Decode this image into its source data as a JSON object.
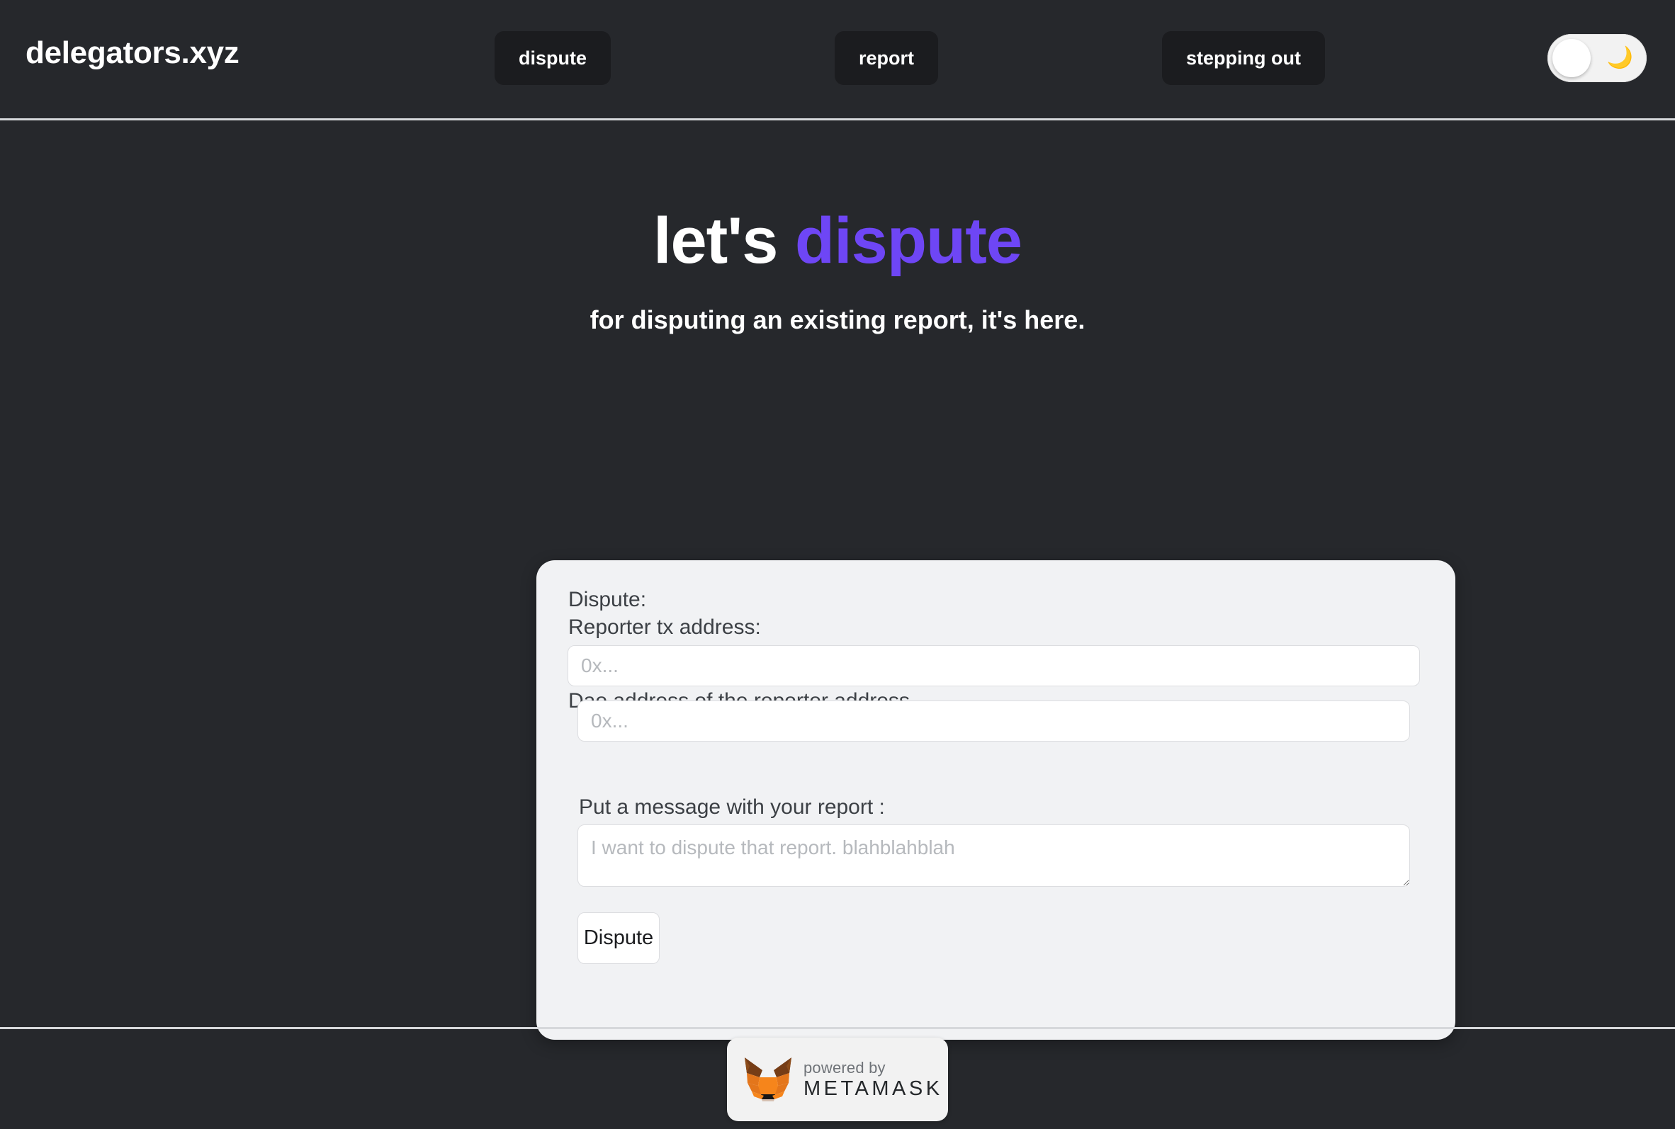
{
  "header": {
    "brand": "delegators.xyz",
    "nav": [
      {
        "label": "dispute"
      },
      {
        "label": "report"
      },
      {
        "label": "stepping out"
      }
    ],
    "theme_toggle": {
      "state": "dark",
      "icon": "crescent-moon-icon",
      "emoji": "🌙"
    }
  },
  "hero": {
    "title_plain": "let's ",
    "title_accent": "dispute",
    "subtitle": "for disputing an existing report, it's here."
  },
  "form": {
    "section_label": "Dispute:",
    "reporter_tx_label": "Reporter tx address:",
    "reporter_tx_placeholder": "0x...",
    "reporter_tx_value": "",
    "dao_address_label": "Dao address of the reporter address",
    "dao_address_placeholder": "0x...",
    "dao_address_value": "",
    "message_label": "Put a message with your report :",
    "message_placeholder": "I want to dispute that report. blahblahblah",
    "message_value": "",
    "submit_label": "Dispute"
  },
  "footer": {
    "metamask": {
      "powered_by": "powered by",
      "name": "METAMASK"
    }
  },
  "colors": {
    "background": "#26282c",
    "accent_purple": "#6e46f5",
    "card_background": "#f1f2f4",
    "nav_button_background": "#1b1c1f",
    "divider": "#d6d8db",
    "label_text": "#3c4045",
    "placeholder_text": "#b6b9bd",
    "metamask_orange": "#e2761b"
  }
}
